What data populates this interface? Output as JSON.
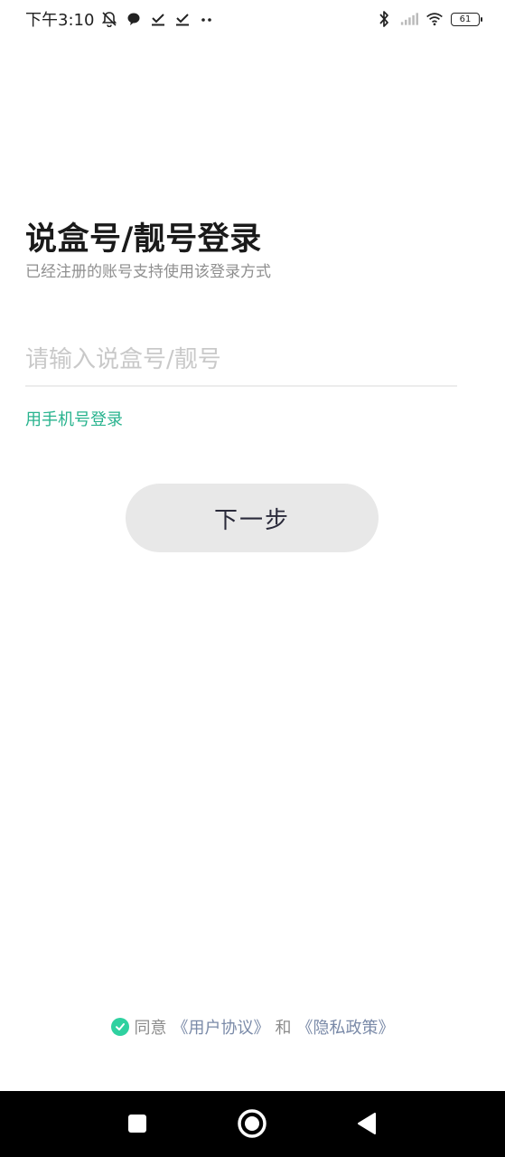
{
  "status_bar": {
    "time": "下午3:10",
    "battery": "61"
  },
  "login": {
    "title": "说盒号/靓号登录",
    "subtitle": "已经注册的账号支持使用该登录方式",
    "input_placeholder": "请输入说盒号/靓号",
    "input_value": "",
    "phone_login_link": "用手机号登录",
    "next_button": "下一步"
  },
  "agreement": {
    "prefix": "同意",
    "user_agreement": "《用户协议》",
    "and": "和",
    "privacy_policy": "《隐私政策》",
    "checked": true
  },
  "nav_bar": {
    "recents_icon": "square-icon",
    "home_icon": "circle-icon",
    "back_icon": "triangle-back-icon"
  },
  "colors": {
    "accent": "#28b38e",
    "check": "#2fd1a0",
    "button_bg": "#e8e8e8"
  }
}
